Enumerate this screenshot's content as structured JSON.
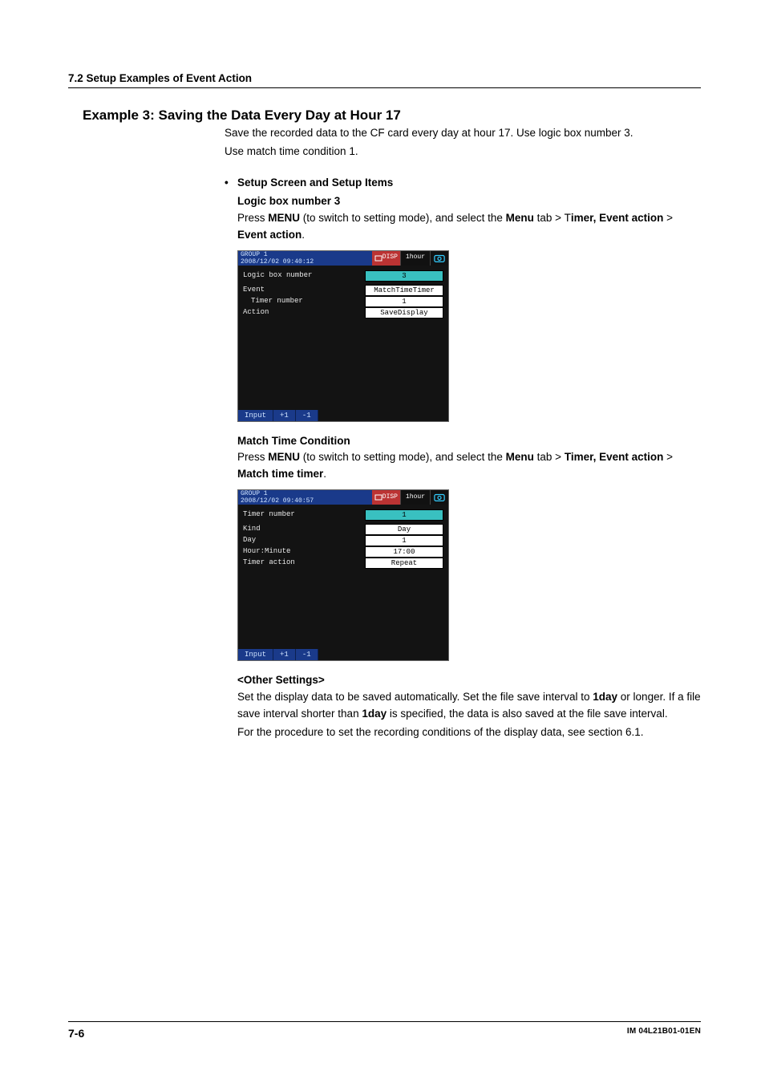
{
  "section_header": "7.2  Setup Examples of Event Action",
  "example_title": "Example 3: Saving the Data Every Day at Hour 17",
  "intro_p1": "Save the recorded data to the CF card every day at hour 17. Use logic box number 3.",
  "intro_p2": "Use match time condition 1.",
  "bullet_heading": "Setup Screen and Setup Items",
  "logic_heading": "Logic box number 3",
  "instr1_pre": "Press ",
  "instr1_menu": "MENU",
  "instr1_mid": " (to switch to setting mode), and select the ",
  "instr1_menutab": "Menu",
  "instr1_tabword": " tab > T",
  "instr1_timer": "imer, Event action",
  "instr1_gt": " > ",
  "instr1_event": "Event action",
  "instr1_end": ".",
  "dev1": {
    "group": "GROUP 1",
    "timestamp": "2008/12/02 09:40:12",
    "disp": "DISP",
    "hour": "1hour",
    "rows": {
      "logic_label": "Logic box number",
      "logic_val": "3",
      "event_label": "Event",
      "event_val": "MatchTimeTimer",
      "timer_label": "Timer number",
      "timer_val": "1",
      "action_label": "Action",
      "action_val": "SaveDisplay"
    },
    "btn_input": "Input",
    "btn_plus": "+1",
    "btn_minus": "-1"
  },
  "match_heading": "Match Time Condition",
  "instr2_pre": "Press ",
  "instr2_menu": "MENU",
  "instr2_mid": " (to switch to setting mode), and select the ",
  "instr2_menutab": "Menu",
  "instr2_tabword": " tab > ",
  "instr2_timer": "Timer, Event action",
  "instr2_gt": " > ",
  "instr2_match": "Match time timer",
  "instr2_end": ".",
  "dev2": {
    "group": "GROUP 1",
    "timestamp": "2008/12/02 09:40:57",
    "disp": "DISP",
    "hour": "1hour",
    "rows": {
      "timer_label": "Timer number",
      "timer_val": "1",
      "kind_label": "Kind",
      "kind_val": "Day",
      "day_label": "Day",
      "day_val": "1",
      "hm_label": "Hour:Minute",
      "hm_val": "17:00",
      "ta_label": "Timer action",
      "ta_val": "Repeat"
    },
    "btn_input": "Input",
    "btn_plus": "+1",
    "btn_minus": "-1"
  },
  "other_heading": "<Other Settings>",
  "other_p1a": "Set the display data to be saved automatically. Set the file save interval to ",
  "other_p1b": "1day",
  "other_p1c": " or longer. If a file save interval shorter than ",
  "other_p1d": "1day",
  "other_p1e": " is specified, the data is also saved at the file save interval.",
  "other_p2": "For the procedure to set the recording conditions of the display data, see section 6.1.",
  "footer_page": "7-6",
  "footer_doc": "IM 04L21B01-01EN"
}
